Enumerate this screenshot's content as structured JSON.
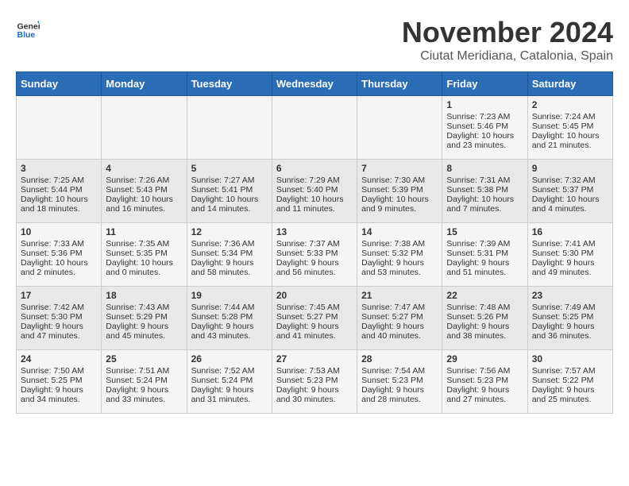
{
  "header": {
    "logo_general": "General",
    "logo_blue": "Blue",
    "month_title": "November 2024",
    "location": "Ciutat Meridiana, Catalonia, Spain"
  },
  "days_of_week": [
    "Sunday",
    "Monday",
    "Tuesday",
    "Wednesday",
    "Thursday",
    "Friday",
    "Saturday"
  ],
  "weeks": [
    [
      {
        "day": "",
        "sunrise": "",
        "sunset": "",
        "daylight": ""
      },
      {
        "day": "",
        "sunrise": "",
        "sunset": "",
        "daylight": ""
      },
      {
        "day": "",
        "sunrise": "",
        "sunset": "",
        "daylight": ""
      },
      {
        "day": "",
        "sunrise": "",
        "sunset": "",
        "daylight": ""
      },
      {
        "day": "",
        "sunrise": "",
        "sunset": "",
        "daylight": ""
      },
      {
        "day": "1",
        "sunrise": "Sunrise: 7:23 AM",
        "sunset": "Sunset: 5:46 PM",
        "daylight": "Daylight: 10 hours and 23 minutes."
      },
      {
        "day": "2",
        "sunrise": "Sunrise: 7:24 AM",
        "sunset": "Sunset: 5:45 PM",
        "daylight": "Daylight: 10 hours and 21 minutes."
      }
    ],
    [
      {
        "day": "3",
        "sunrise": "Sunrise: 7:25 AM",
        "sunset": "Sunset: 5:44 PM",
        "daylight": "Daylight: 10 hours and 18 minutes."
      },
      {
        "day": "4",
        "sunrise": "Sunrise: 7:26 AM",
        "sunset": "Sunset: 5:43 PM",
        "daylight": "Daylight: 10 hours and 16 minutes."
      },
      {
        "day": "5",
        "sunrise": "Sunrise: 7:27 AM",
        "sunset": "Sunset: 5:41 PM",
        "daylight": "Daylight: 10 hours and 14 minutes."
      },
      {
        "day": "6",
        "sunrise": "Sunrise: 7:29 AM",
        "sunset": "Sunset: 5:40 PM",
        "daylight": "Daylight: 10 hours and 11 minutes."
      },
      {
        "day": "7",
        "sunrise": "Sunrise: 7:30 AM",
        "sunset": "Sunset: 5:39 PM",
        "daylight": "Daylight: 10 hours and 9 minutes."
      },
      {
        "day": "8",
        "sunrise": "Sunrise: 7:31 AM",
        "sunset": "Sunset: 5:38 PM",
        "daylight": "Daylight: 10 hours and 7 minutes."
      },
      {
        "day": "9",
        "sunrise": "Sunrise: 7:32 AM",
        "sunset": "Sunset: 5:37 PM",
        "daylight": "Daylight: 10 hours and 4 minutes."
      }
    ],
    [
      {
        "day": "10",
        "sunrise": "Sunrise: 7:33 AM",
        "sunset": "Sunset: 5:36 PM",
        "daylight": "Daylight: 10 hours and 2 minutes."
      },
      {
        "day": "11",
        "sunrise": "Sunrise: 7:35 AM",
        "sunset": "Sunset: 5:35 PM",
        "daylight": "Daylight: 10 hours and 0 minutes."
      },
      {
        "day": "12",
        "sunrise": "Sunrise: 7:36 AM",
        "sunset": "Sunset: 5:34 PM",
        "daylight": "Daylight: 9 hours and 58 minutes."
      },
      {
        "day": "13",
        "sunrise": "Sunrise: 7:37 AM",
        "sunset": "Sunset: 5:33 PM",
        "daylight": "Daylight: 9 hours and 56 minutes."
      },
      {
        "day": "14",
        "sunrise": "Sunrise: 7:38 AM",
        "sunset": "Sunset: 5:32 PM",
        "daylight": "Daylight: 9 hours and 53 minutes."
      },
      {
        "day": "15",
        "sunrise": "Sunrise: 7:39 AM",
        "sunset": "Sunset: 5:31 PM",
        "daylight": "Daylight: 9 hours and 51 minutes."
      },
      {
        "day": "16",
        "sunrise": "Sunrise: 7:41 AM",
        "sunset": "Sunset: 5:30 PM",
        "daylight": "Daylight: 9 hours and 49 minutes."
      }
    ],
    [
      {
        "day": "17",
        "sunrise": "Sunrise: 7:42 AM",
        "sunset": "Sunset: 5:30 PM",
        "daylight": "Daylight: 9 hours and 47 minutes."
      },
      {
        "day": "18",
        "sunrise": "Sunrise: 7:43 AM",
        "sunset": "Sunset: 5:29 PM",
        "daylight": "Daylight: 9 hours and 45 minutes."
      },
      {
        "day": "19",
        "sunrise": "Sunrise: 7:44 AM",
        "sunset": "Sunset: 5:28 PM",
        "daylight": "Daylight: 9 hours and 43 minutes."
      },
      {
        "day": "20",
        "sunrise": "Sunrise: 7:45 AM",
        "sunset": "Sunset: 5:27 PM",
        "daylight": "Daylight: 9 hours and 41 minutes."
      },
      {
        "day": "21",
        "sunrise": "Sunrise: 7:47 AM",
        "sunset": "Sunset: 5:27 PM",
        "daylight": "Daylight: 9 hours and 40 minutes."
      },
      {
        "day": "22",
        "sunrise": "Sunrise: 7:48 AM",
        "sunset": "Sunset: 5:26 PM",
        "daylight": "Daylight: 9 hours and 38 minutes."
      },
      {
        "day": "23",
        "sunrise": "Sunrise: 7:49 AM",
        "sunset": "Sunset: 5:25 PM",
        "daylight": "Daylight: 9 hours and 36 minutes."
      }
    ],
    [
      {
        "day": "24",
        "sunrise": "Sunrise: 7:50 AM",
        "sunset": "Sunset: 5:25 PM",
        "daylight": "Daylight: 9 hours and 34 minutes."
      },
      {
        "day": "25",
        "sunrise": "Sunrise: 7:51 AM",
        "sunset": "Sunset: 5:24 PM",
        "daylight": "Daylight: 9 hours and 33 minutes."
      },
      {
        "day": "26",
        "sunrise": "Sunrise: 7:52 AM",
        "sunset": "Sunset: 5:24 PM",
        "daylight": "Daylight: 9 hours and 31 minutes."
      },
      {
        "day": "27",
        "sunrise": "Sunrise: 7:53 AM",
        "sunset": "Sunset: 5:23 PM",
        "daylight": "Daylight: 9 hours and 30 minutes."
      },
      {
        "day": "28",
        "sunrise": "Sunrise: 7:54 AM",
        "sunset": "Sunset: 5:23 PM",
        "daylight": "Daylight: 9 hours and 28 minutes."
      },
      {
        "day": "29",
        "sunrise": "Sunrise: 7:56 AM",
        "sunset": "Sunset: 5:23 PM",
        "daylight": "Daylight: 9 hours and 27 minutes."
      },
      {
        "day": "30",
        "sunrise": "Sunrise: 7:57 AM",
        "sunset": "Sunset: 5:22 PM",
        "daylight": "Daylight: 9 hours and 25 minutes."
      }
    ]
  ]
}
